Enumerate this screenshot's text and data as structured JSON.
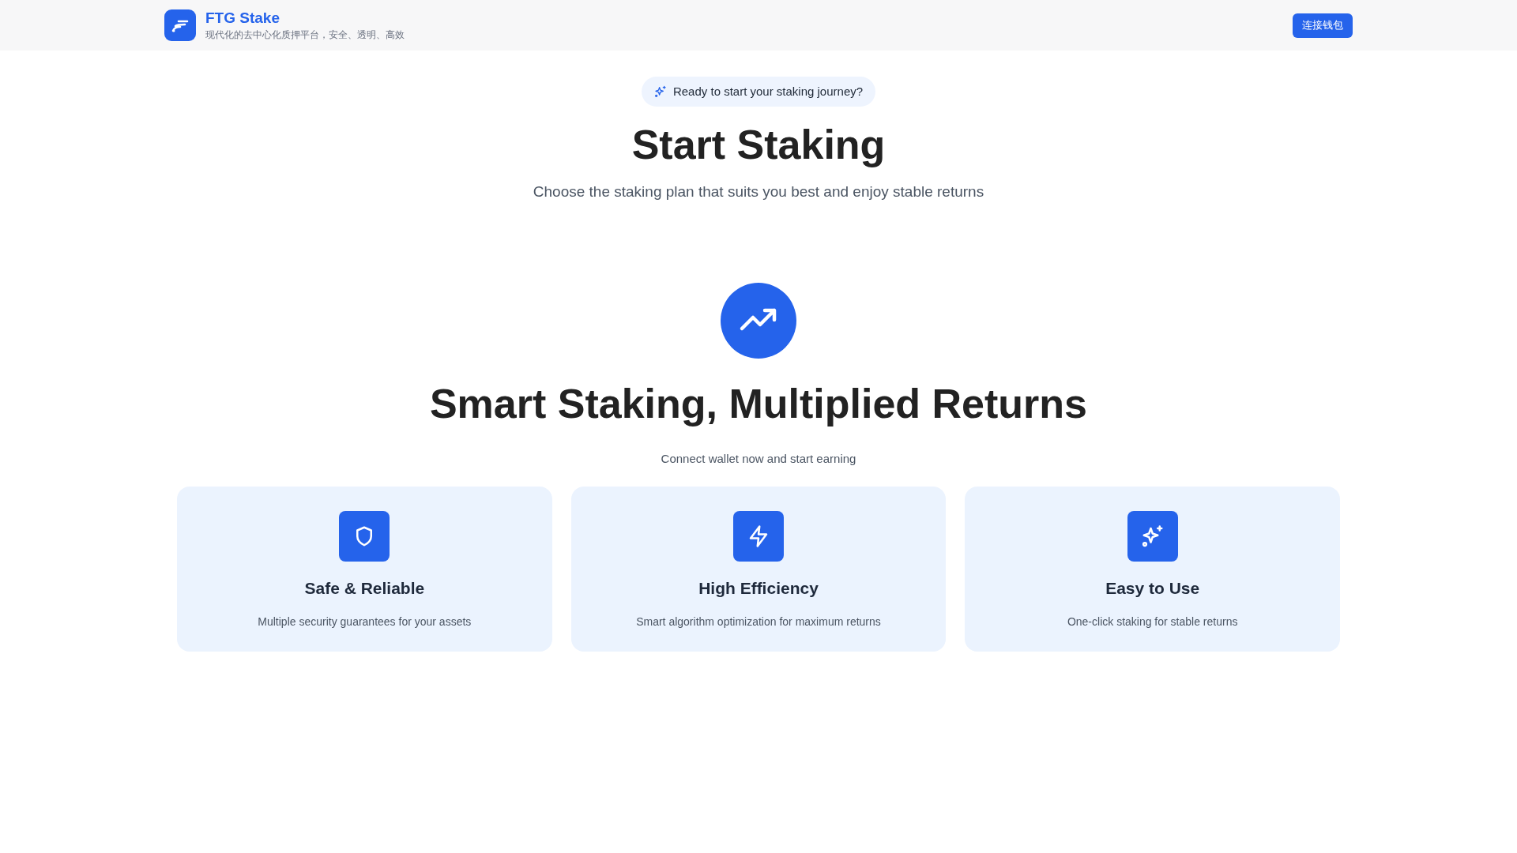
{
  "header": {
    "brand": "FTG Stake",
    "tagline": "现代化的去中心化质押平台，安全、透明、高效",
    "connect_button": "连接钱包"
  },
  "hero": {
    "badge": "Ready to start your staking journey?",
    "title": "Start Staking",
    "subtitle": "Choose the staking plan that suits you best and enjoy stable returns"
  },
  "promo": {
    "heading": "Smart Staking, Multiplied Returns",
    "subheading": "Connect wallet now and start earning",
    "features": [
      {
        "kind": "shield",
        "title": "Safe & Reliable",
        "description": "Multiple security guarantees for your assets"
      },
      {
        "kind": "bolt",
        "title": "High Efficiency",
        "description": "Smart algorithm optimization for maximum returns"
      },
      {
        "kind": "sparkles",
        "title": "Easy to Use",
        "description": "One-click staking for stable returns"
      }
    ]
  }
}
